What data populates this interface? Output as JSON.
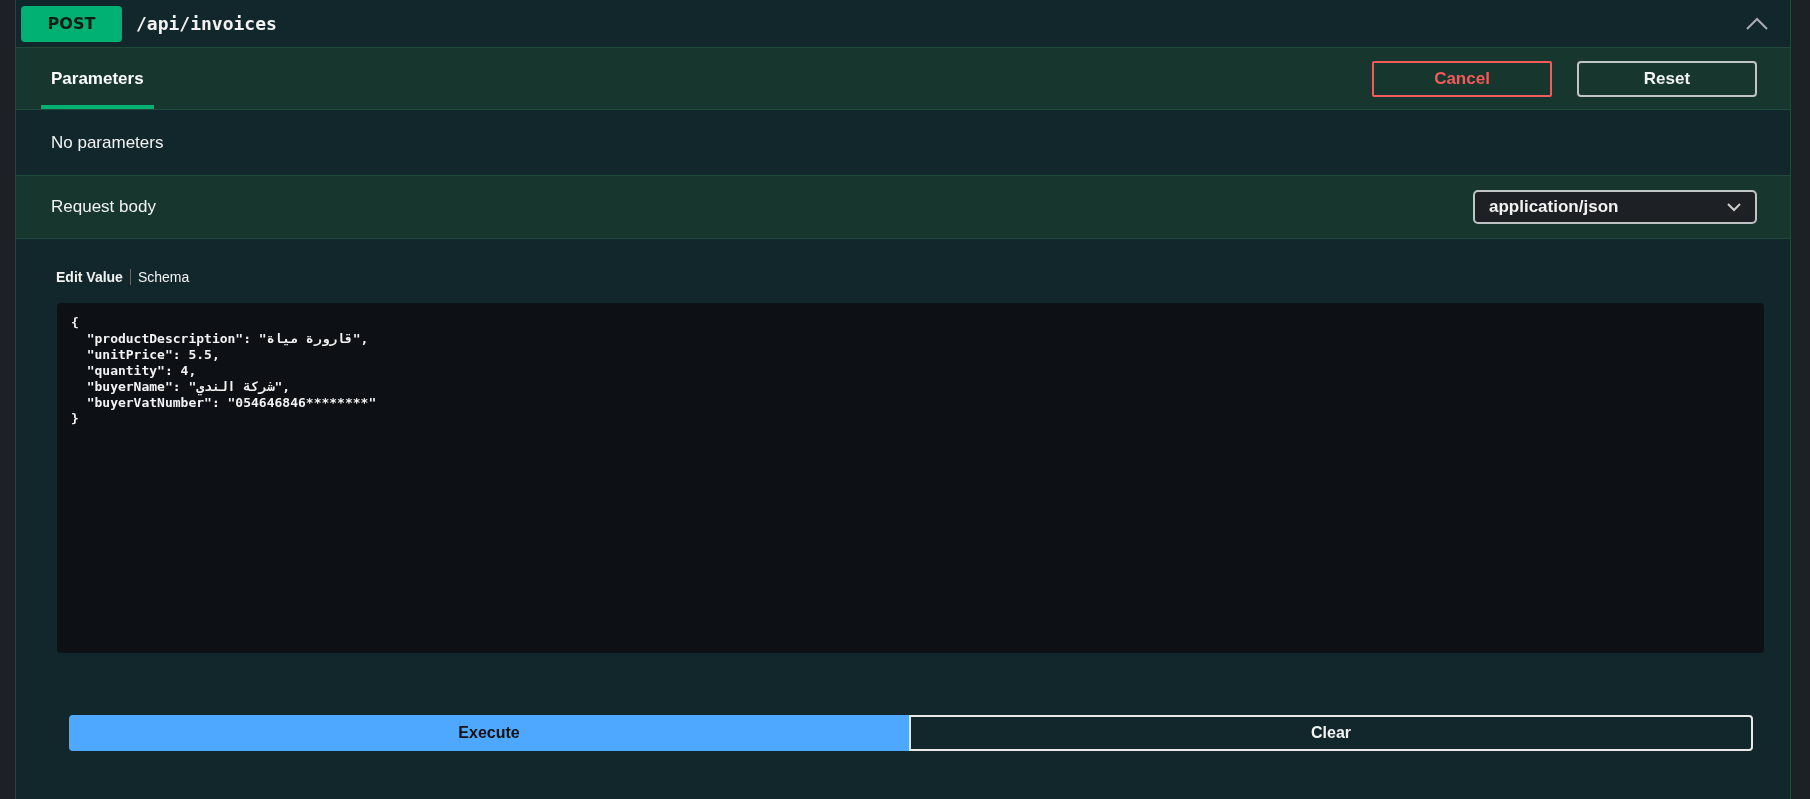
{
  "operation": {
    "method": "POST",
    "path": "/api/invoices",
    "expanded": true
  },
  "tabs": [
    {
      "label": "Parameters",
      "selected": true
    }
  ],
  "actions": [
    {
      "label": "Cancel",
      "kind": "danger"
    },
    {
      "label": "Reset",
      "kind": "plain"
    }
  ],
  "parameters_note": "No parameters",
  "request_body": {
    "title": "Request body",
    "content_type": "application/json"
  },
  "editor_tabs": [
    {
      "label": "Edit Value",
      "selected": true
    },
    {
      "label": "Schema",
      "selected": false
    }
  ],
  "body_lines": [
    "{",
    "  \"productDescription\": \"قارورة مياة\",",
    "  \"unitPrice\": 5.5,",
    "  \"quantity\": 4,",
    "  \"buyerName\": \"شركة الندي\",",
    "  \"buyerVatNumber\": \"054646846********\"",
    "}"
  ],
  "buttons": [
    {
      "label": "Execute",
      "kind": "primary"
    },
    {
      "label": "Clear",
      "kind": "outline"
    }
  ]
}
